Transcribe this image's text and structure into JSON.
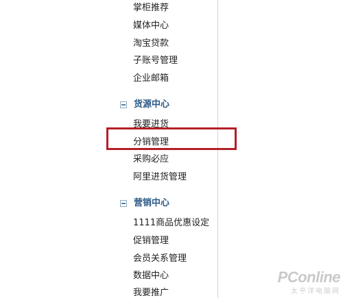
{
  "sidebar": {
    "top_items": [
      {
        "label": "掌柜推荐"
      },
      {
        "label": "媒体中心"
      },
      {
        "label": "淘宝贷款"
      },
      {
        "label": "子账号管理"
      },
      {
        "label": "企业邮箱"
      }
    ],
    "groups": [
      {
        "title": "货源中心",
        "items": [
          {
            "label": "我要进货"
          },
          {
            "label": "分销管理",
            "highlighted": true
          },
          {
            "label": "采购必应"
          },
          {
            "label": "阿里进货管理"
          }
        ]
      },
      {
        "title": "营销中心",
        "items": [
          {
            "label": "1111商品优惠设定"
          },
          {
            "label": "促销管理"
          },
          {
            "label": "会员关系管理"
          },
          {
            "label": "数据中心"
          },
          {
            "label": "我要推广"
          }
        ]
      }
    ]
  },
  "watermark": {
    "logo": "PConline",
    "subtitle": "太平洋电脑网"
  },
  "colors": {
    "group_title": "#2c5a86",
    "highlight_border": "#b31e26"
  }
}
